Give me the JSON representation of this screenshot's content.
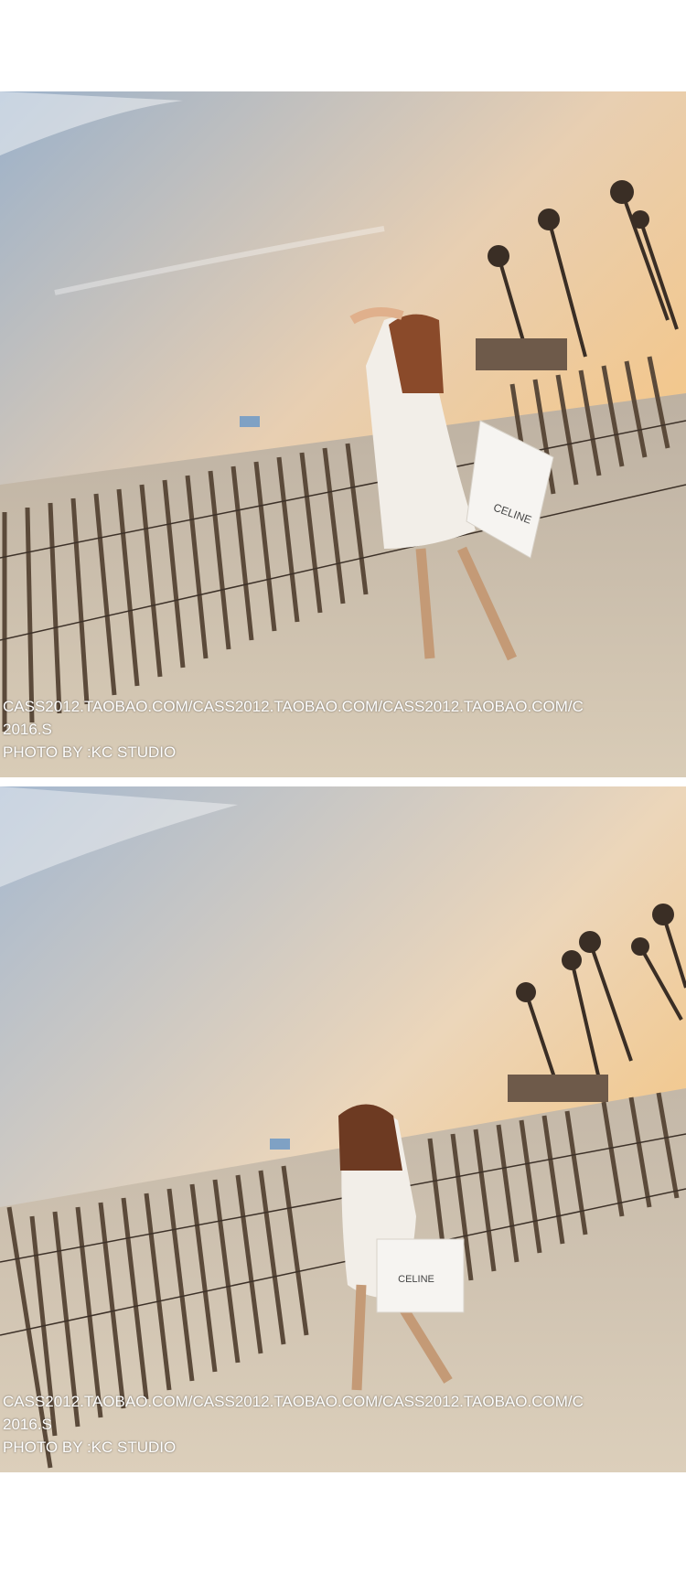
{
  "photos": [
    {
      "watermark_line1": "CASS2012.TAOBAO.COM/CASS2012.TAOBAO.COM/CASS2012.TAOBAO.COM/C",
      "watermark_line2": "2016.S",
      "credit": "PHOTO BY :KC STUDIO",
      "bag_text": "CELINE"
    },
    {
      "watermark_line1": "CASS2012.TAOBAO.COM/CASS2012.TAOBAO.COM/CASS2012.TAOBAO.COM/C",
      "watermark_line2": "2016.S",
      "credit": "PHOTO BY :KC STUDIO",
      "bag_text": "CELINE"
    }
  ],
  "colors": {
    "sky_top": "#9fb4cc",
    "sky_mid": "#f3d2a6",
    "sky_horizon": "#f7b865",
    "sand": "#cdbfa9",
    "fence": "#5b4a3a"
  }
}
